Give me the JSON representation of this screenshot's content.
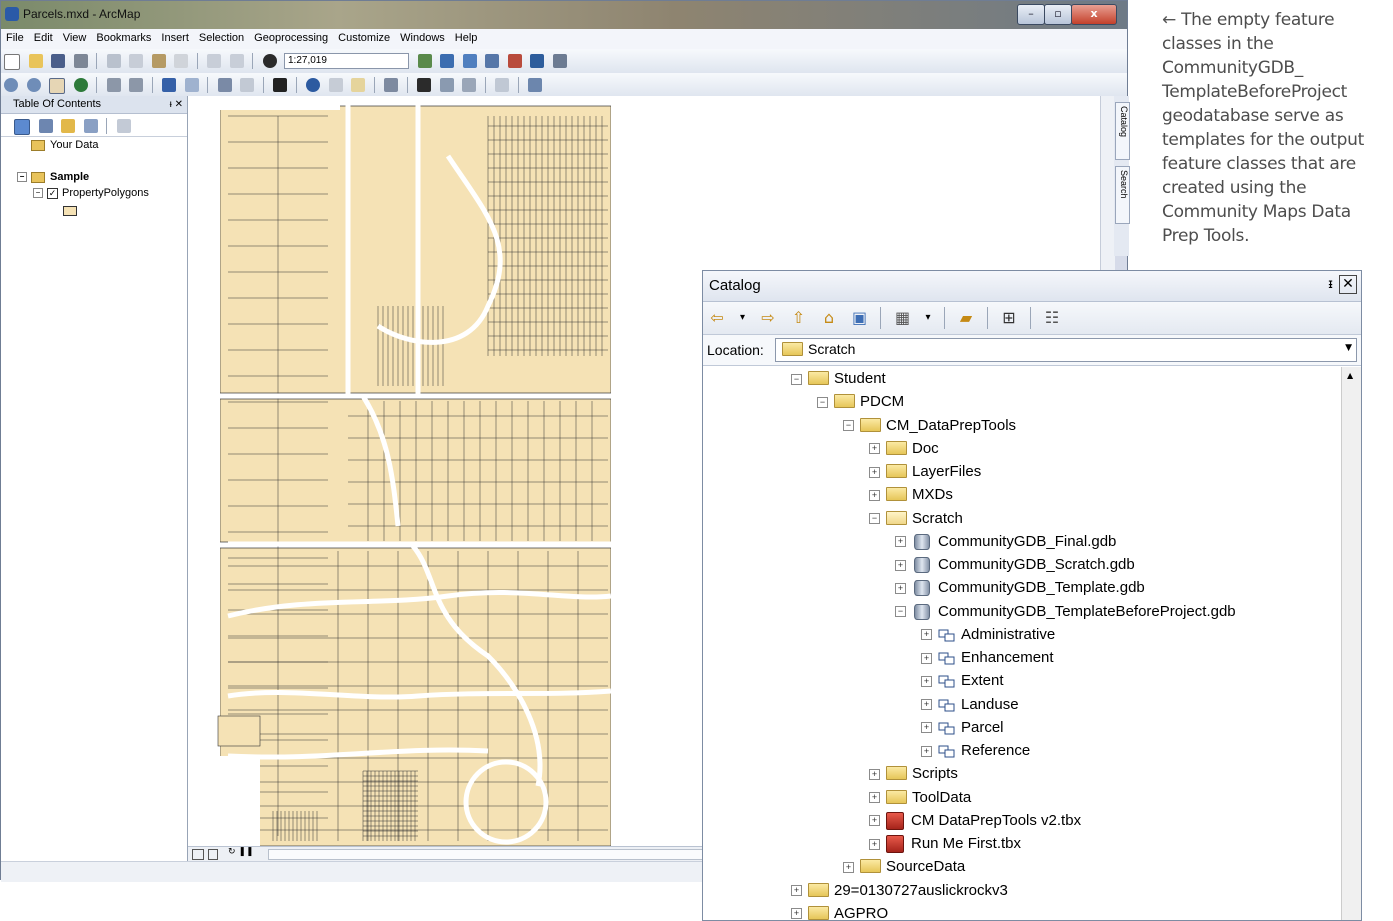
{
  "window": {
    "title": "Parcels.mxd - ArcMap"
  },
  "menu": [
    "File",
    "Edit",
    "View",
    "Bookmarks",
    "Insert",
    "Selection",
    "Geoprocessing",
    "Customize",
    "Windows",
    "Help"
  ],
  "toolbar": {
    "scale_value": "1:27,019"
  },
  "toc": {
    "title": "Table Of Contents",
    "layers": [
      {
        "label": "Your Data"
      },
      {
        "label": "Sample"
      },
      {
        "label": "PropertyPolygons"
      }
    ]
  },
  "side_tabs": [
    "Catalog",
    "Search"
  ],
  "annotation": {
    "arrow": "←",
    "text": "The empty feature classes in the CommunityGDB_ TemplateBeforeProject geodatabase serve as templates for the output feature classes that are created using the Community Maps Data Prep Tools."
  },
  "catalog": {
    "title": "Catalog",
    "location_label": "Location:",
    "location_value": "Scratch",
    "tree": [
      {
        "label": "Student",
        "level": 0,
        "type": "folder",
        "state": "open"
      },
      {
        "label": "PDCM",
        "level": 1,
        "type": "folder",
        "state": "open"
      },
      {
        "label": "CM_DataPrepTools",
        "level": 2,
        "type": "folder",
        "state": "open"
      },
      {
        "label": "Doc",
        "level": 3,
        "type": "folder",
        "state": "closed"
      },
      {
        "label": "LayerFiles",
        "level": 3,
        "type": "folder",
        "state": "closed"
      },
      {
        "label": "MXDs",
        "level": 3,
        "type": "folder",
        "state": "closed"
      },
      {
        "label": "Scratch",
        "level": 3,
        "type": "folder-open",
        "state": "open"
      },
      {
        "label": "CommunityGDB_Final.gdb",
        "level": 4,
        "type": "gdb",
        "state": "closed"
      },
      {
        "label": "CommunityGDB_Scratch.gdb",
        "level": 4,
        "type": "gdb",
        "state": "closed"
      },
      {
        "label": "CommunityGDB_Template.gdb",
        "level": 4,
        "type": "gdb",
        "state": "closed"
      },
      {
        "label": "CommunityGDB_TemplateBeforeProject.gdb",
        "level": 4,
        "type": "gdb",
        "state": "open"
      },
      {
        "label": "Administrative",
        "level": 5,
        "type": "dataset",
        "state": "closed"
      },
      {
        "label": "Enhancement",
        "level": 5,
        "type": "dataset",
        "state": "closed"
      },
      {
        "label": "Extent",
        "level": 5,
        "type": "dataset",
        "state": "closed"
      },
      {
        "label": "Landuse",
        "level": 5,
        "type": "dataset",
        "state": "closed"
      },
      {
        "label": "Parcel",
        "level": 5,
        "type": "dataset",
        "state": "closed"
      },
      {
        "label": "Reference",
        "level": 5,
        "type": "dataset",
        "state": "closed"
      },
      {
        "label": "Scripts",
        "level": 3,
        "type": "folder",
        "state": "closed"
      },
      {
        "label": "ToolData",
        "level": 3,
        "type": "folder",
        "state": "closed"
      },
      {
        "label": "CM DataPrepTools v2.tbx",
        "level": 3,
        "type": "toolbox",
        "state": "closed"
      },
      {
        "label": "Run Me First.tbx",
        "level": 3,
        "type": "toolbox",
        "state": "closed"
      },
      {
        "label": "SourceData",
        "level": 2,
        "type": "folder",
        "state": "closed"
      },
      {
        "label": "29=0130727auslickrockv3",
        "level": 0,
        "type": "folder",
        "state": "closed"
      },
      {
        "label": "AGPRO",
        "level": 0,
        "type": "folder",
        "state": "closed"
      }
    ]
  },
  "colors": {
    "parcel_fill": "#f5e2b5",
    "parcel_stroke": "#3b3b3b",
    "road": "#ffffff"
  }
}
